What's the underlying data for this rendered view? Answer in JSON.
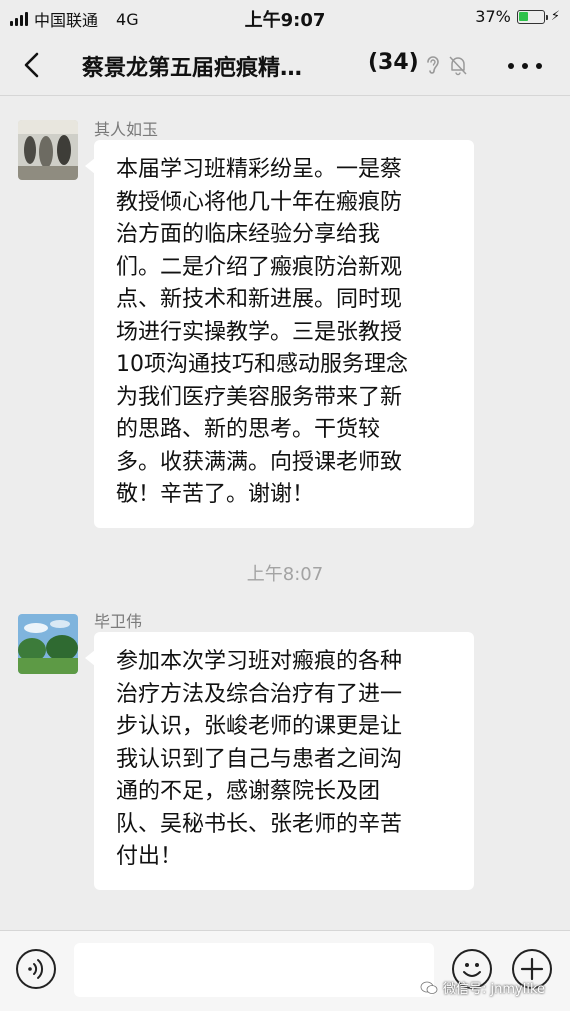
{
  "status_bar": {
    "carrier": "中国联通",
    "network": "4G",
    "time": "上午9:07",
    "battery_percent": "37%",
    "battery_level": 0.37,
    "signal_bars": 4
  },
  "header": {
    "title": "蔡景龙第五届疤痕精…",
    "member_count": "(34)",
    "icons": [
      "back-icon",
      "ear-icon",
      "mute-bell-icon",
      "more-icon"
    ]
  },
  "messages": [
    {
      "sender": "其人如玉",
      "text": "本届学习班精彩纷呈。一是蔡\n教授倾心将他几十年在瘢痕防\n治方面的临床经验分享给我\n们。二是介绍了瘢痕防治新观\n点、新技术和新进展。同时现\n场进行实操教学。三是张教授\n10项沟通技巧和感动服务理念\n为我们医疗美容服务带来了新\n的思路、新的思考。干货较\n多。收获满满。向授课老师致\n敬！辛苦了。谢谢！"
    },
    {
      "sender": "毕卫伟",
      "text": "参加本次学习班对瘢痕的各种\n治疗方法及综合治疗有了进一\n步认识，张峻老师的课更是让\n我认识到了自己与患者之间沟\n通的不足，感谢蔡院长及团\n队、吴秘书长、张老师的辛苦\n付出！"
    }
  ],
  "time_separator": "上午8:07",
  "input_bar": {
    "icons": [
      "voice-icon",
      "emoji-icon",
      "plus-icon"
    ]
  },
  "watermark": {
    "label": "微信号: jnmylike"
  },
  "colors": {
    "background": "#ededed",
    "bubble": "#ffffff",
    "battery": "#2fc14a",
    "meta_text": "#7a7a7a"
  }
}
